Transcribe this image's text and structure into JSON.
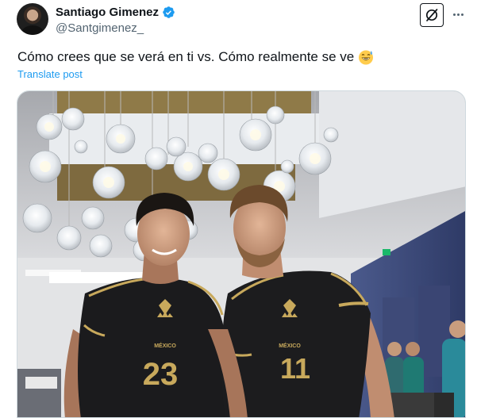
{
  "author": {
    "display_name": "Santiago Gimenez",
    "handle": "@Santgimenez_",
    "verified": true,
    "avatar_icon": "profile-avatar"
  },
  "post": {
    "text": "Cómo crees que se verá en ti vs. Cómo realmente se ve",
    "emoji": "grinning-squinting-face-with-sweat-emoji",
    "translate_label": "Translate post"
  },
  "media": {
    "jersey_left_number": "23",
    "jersey_right_number": "11",
    "jersey_crest_text": "MÉXICO"
  },
  "icons": {
    "grok": "grok-icon",
    "more": "more-options-icon",
    "verified": "verified-badge-icon"
  },
  "colors": {
    "accent": "#1d9bf0",
    "secondary_text": "#536471",
    "jersey_gold": "#c8a95c"
  }
}
